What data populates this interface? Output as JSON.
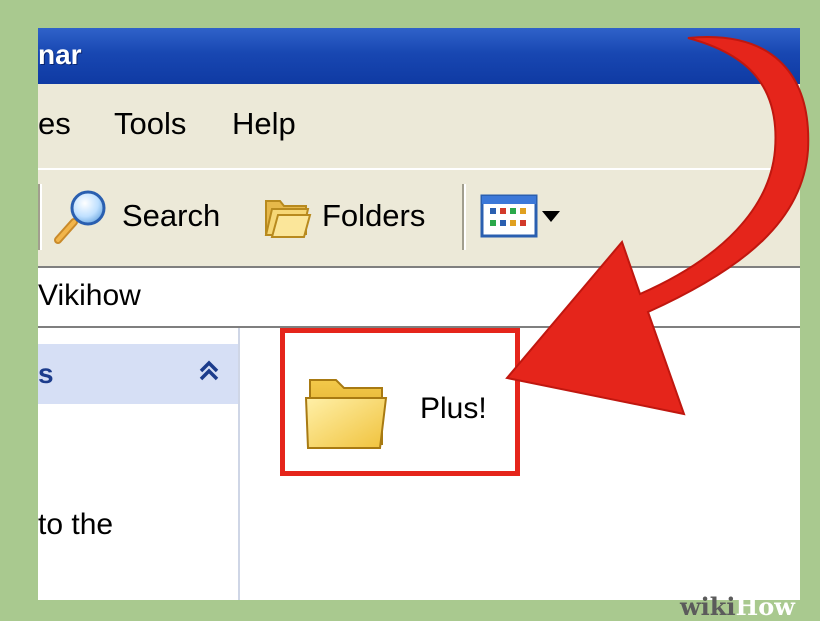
{
  "window": {
    "title_fragment": "nar"
  },
  "menu": {
    "items": [
      {
        "label": "es"
      },
      {
        "label": "Tools"
      },
      {
        "label": "Help"
      }
    ]
  },
  "toolbar": {
    "search_label": "Search",
    "search_icon": "magnifier-icon",
    "folders_label": "Folders",
    "folders_icon": "folders-icon",
    "views_icon": "views-icon",
    "views_dropdown_icon": "dropdown-arrow-icon"
  },
  "address": {
    "text": "Vikihow"
  },
  "tasks": {
    "header": "s",
    "collapse_glyph": "⌃",
    "body_text": "to the"
  },
  "content": {
    "items": [
      {
        "label": "Plus!",
        "icon": "folder-icon"
      }
    ]
  },
  "annotation": {
    "highlight_color": "#e5251b",
    "arrow_color": "#e5251b"
  },
  "watermark": {
    "wiki": "wiki",
    "how": "How"
  }
}
